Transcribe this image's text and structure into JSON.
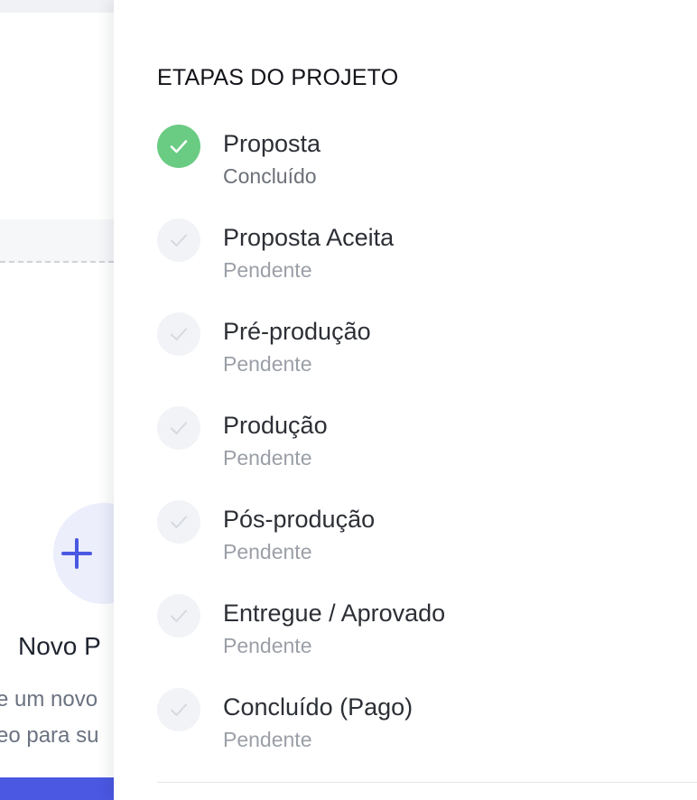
{
  "background": {
    "new_project_title": "Novo P",
    "new_project_desc_line1": "e um novo",
    "new_project_desc_line2": "eo para su",
    "plus_icon": "plus-icon"
  },
  "drawer": {
    "heading": "ETAPAS DO PROJETO",
    "steps": [
      {
        "name": "Proposta",
        "status": "Concluído",
        "completed": true
      },
      {
        "name": "Proposta Aceita",
        "status": "Pendente",
        "completed": false
      },
      {
        "name": "Pré-produção",
        "status": "Pendente",
        "completed": false
      },
      {
        "name": "Produção",
        "status": "Pendente",
        "completed": false
      },
      {
        "name": "Pós-produção",
        "status": "Pendente",
        "completed": false
      },
      {
        "name": "Entregue / Aprovado",
        "status": "Pendente",
        "completed": false
      },
      {
        "name": "Concluído (Pago)",
        "status": "Pendente",
        "completed": false
      }
    ]
  },
  "colors": {
    "completed": "#6acb83",
    "pending_bg": "#f1f3f6",
    "accent": "#4a58e2"
  }
}
